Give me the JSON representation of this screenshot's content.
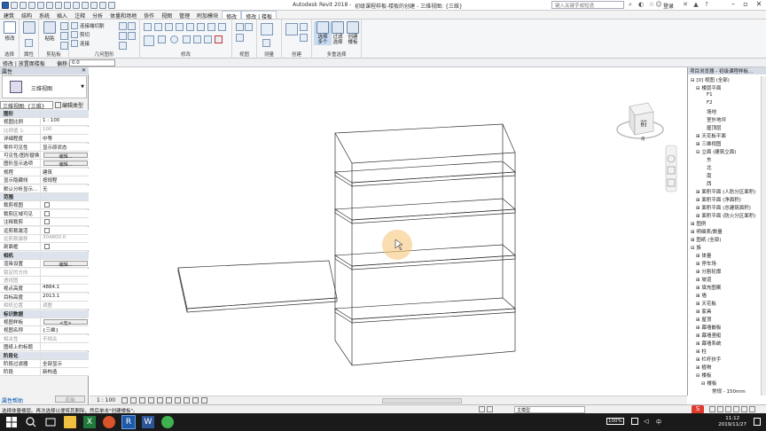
{
  "titlebar": {
    "app_name": "Autodesk Revit 2018 -",
    "doc_name": "初级课程样板-楼板的创建 - 三维视图: {三维}",
    "search_placeholder": "键入关键字或短语",
    "login": "登录"
  },
  "menu": [
    "建筑",
    "结构",
    "系统",
    "插入",
    "注释",
    "分析",
    "体量和场地",
    "协作",
    "视图",
    "管理",
    "附加模块",
    "修改",
    "修改 | 楼板"
  ],
  "menu_active": [
    "修改",
    "修改 | 楼板"
  ],
  "ribbon": {
    "select_label": "修改",
    "select_panel": "选择",
    "props_panel": "属性",
    "clipboard_panel": "剪贴板",
    "geometry_panel": "几何图形",
    "modify_panel": "修改",
    "view_panel": "视图",
    "measure_panel": "测量",
    "create_panel": "创建",
    "multiselect_panel": "多重选择",
    "connect_cut": "连接端切割",
    "cut": "剪切",
    "join": "连接",
    "paste": "粘贴",
    "filter_btn": "选择\n多个",
    "filter_btn2": "过滤\n选择",
    "create_similar": "创建\n楼板"
  },
  "options": {
    "mode": "修改 | 放置面楼板",
    "offset_label": "偏移:",
    "offset_value": "0.0"
  },
  "properties": {
    "title": "属性",
    "type_name": "三维视图",
    "type_selector": "三维视图: {三维}",
    "edit_type": "编辑类型",
    "rows": [
      {
        "k": "图形",
        "v": "",
        "sec": true
      },
      {
        "k": "视图比例",
        "v": "1 : 100"
      },
      {
        "k": "比例值 1:",
        "v": "100",
        "gray": true
      },
      {
        "k": "详细程度",
        "v": "中等"
      },
      {
        "k": "零件可见性",
        "v": "显示原状态"
      },
      {
        "k": "可见性/图形替换",
        "v": "编辑...",
        "btn": true
      },
      {
        "k": "图形显示选项",
        "v": "编辑...",
        "btn": true
      },
      {
        "k": "规程",
        "v": "建筑"
      },
      {
        "k": "显示隐藏线",
        "v": "按规程"
      },
      {
        "k": "默认分析显示...",
        "v": "无"
      },
      {
        "k": "范围",
        "v": "",
        "sec": true
      },
      {
        "k": "裁剪视图",
        "v": "",
        "cb": true
      },
      {
        "k": "裁剪区域可见",
        "v": "",
        "cb": true
      },
      {
        "k": "注释裁剪",
        "v": "",
        "cb": true
      },
      {
        "k": "远剪裁激活",
        "v": "",
        "cb": true
      },
      {
        "k": "远剪裁偏移",
        "v": "304800.0",
        "gray": true
      },
      {
        "k": "剖面框",
        "v": "",
        "cb": true
      },
      {
        "k": "相机",
        "v": "",
        "sec": true
      },
      {
        "k": "渲染设置",
        "v": "编辑...",
        "btn": true
      },
      {
        "k": "锁定的方向",
        "v": "",
        "gray": true
      },
      {
        "k": "透视图",
        "v": "",
        "gray": true
      },
      {
        "k": "视点高度",
        "v": "4884.1"
      },
      {
        "k": "目标高度",
        "v": "2013.1"
      },
      {
        "k": "相机位置",
        "v": "调整",
        "gray": true
      },
      {
        "k": "标识数据",
        "v": "",
        "sec": true
      },
      {
        "k": "视图样板",
        "v": "<无>",
        "btn": true
      },
      {
        "k": "视图名称",
        "v": "{三维}"
      },
      {
        "k": "相关性",
        "v": "不相关",
        "gray": true
      },
      {
        "k": "图纸上的标题",
        "v": ""
      },
      {
        "k": "阶段化",
        "v": "",
        "sec": true
      },
      {
        "k": "阶段过滤器",
        "v": "全部显示"
      },
      {
        "k": "阶段",
        "v": "新构造"
      }
    ],
    "help": "属性帮助",
    "apply": "应用"
  },
  "viewcube": {
    "face": "前"
  },
  "viewbar": {
    "scale": "1 : 100"
  },
  "browser": {
    "title": "项目浏览器 - 初级课程样板...",
    "items": [
      {
        "t": "⊟ [0] 视图 (全部)",
        "lvl": 0
      },
      {
        "t": "⊟ 楼层平面",
        "lvl": 1
      },
      {
        "t": "F1",
        "lvl": 3
      },
      {
        "t": "F2",
        "lvl": 3
      },
      {
        "t": "场地",
        "lvl": 3
      },
      {
        "t": "室外地坪",
        "lvl": 3
      },
      {
        "t": "屋顶层",
        "lvl": 3
      },
      {
        "t": "⊞ 天花板平面",
        "lvl": 1
      },
      {
        "t": "⊞ 三维视图",
        "lvl": 1
      },
      {
        "t": "⊟ 立面 (建筑立面)",
        "lvl": 1
      },
      {
        "t": "东",
        "lvl": 3
      },
      {
        "t": "北",
        "lvl": 3
      },
      {
        "t": "南",
        "lvl": 3
      },
      {
        "t": "西",
        "lvl": 3
      },
      {
        "t": "⊞ 面积平面 (人防分区面积)",
        "lvl": 1
      },
      {
        "t": "⊞ 面积平面 (净面积)",
        "lvl": 1
      },
      {
        "t": "⊞ 面积平面 (总建筑面积)",
        "lvl": 1
      },
      {
        "t": "⊞ 面积平面 (防火分区面积)",
        "lvl": 1
      },
      {
        "t": "⊞ 图例",
        "lvl": 0
      },
      {
        "t": "⊞ 明细表/数量",
        "lvl": 0
      },
      {
        "t": "⊞ 图纸 (全部)",
        "lvl": 0
      },
      {
        "t": "⊟ 族",
        "lvl": 0
      },
      {
        "t": "⊞ 体量",
        "lvl": 1
      },
      {
        "t": "⊞ 停车场",
        "lvl": 1
      },
      {
        "t": "⊞ 分割轮廓",
        "lvl": 1
      },
      {
        "t": "⊞ 坡道",
        "lvl": 1
      },
      {
        "t": "⊞ 填充图案",
        "lvl": 1
      },
      {
        "t": "⊞ 墙",
        "lvl": 1
      },
      {
        "t": "⊞ 天花板",
        "lvl": 1
      },
      {
        "t": "⊞ 家具",
        "lvl": 1
      },
      {
        "t": "⊞ 屋顶",
        "lvl": 1
      },
      {
        "t": "⊞ 幕墙嵌板",
        "lvl": 1
      },
      {
        "t": "⊞ 幕墙竖梃",
        "lvl": 1
      },
      {
        "t": "⊞ 幕墙系统",
        "lvl": 1
      },
      {
        "t": "⊞ 柱",
        "lvl": 1
      },
      {
        "t": "⊞ 栏杆扶手",
        "lvl": 1
      },
      {
        "t": "⊞ 植物",
        "lvl": 1
      },
      {
        "t": "⊟ 楼板",
        "lvl": 1
      },
      {
        "t": "⊟ 楼板",
        "lvl": 2
      },
      {
        "t": "常规 - 150mm",
        "lvl": 4
      }
    ]
  },
  "status": {
    "text": "选择体量楼层。再次选择以便将其删除，然后单击\"创建楼板\"。",
    "workset": "主模型"
  },
  "taskbar": {
    "battery": "100%",
    "time": "11:12",
    "date": "2019/11/27"
  }
}
